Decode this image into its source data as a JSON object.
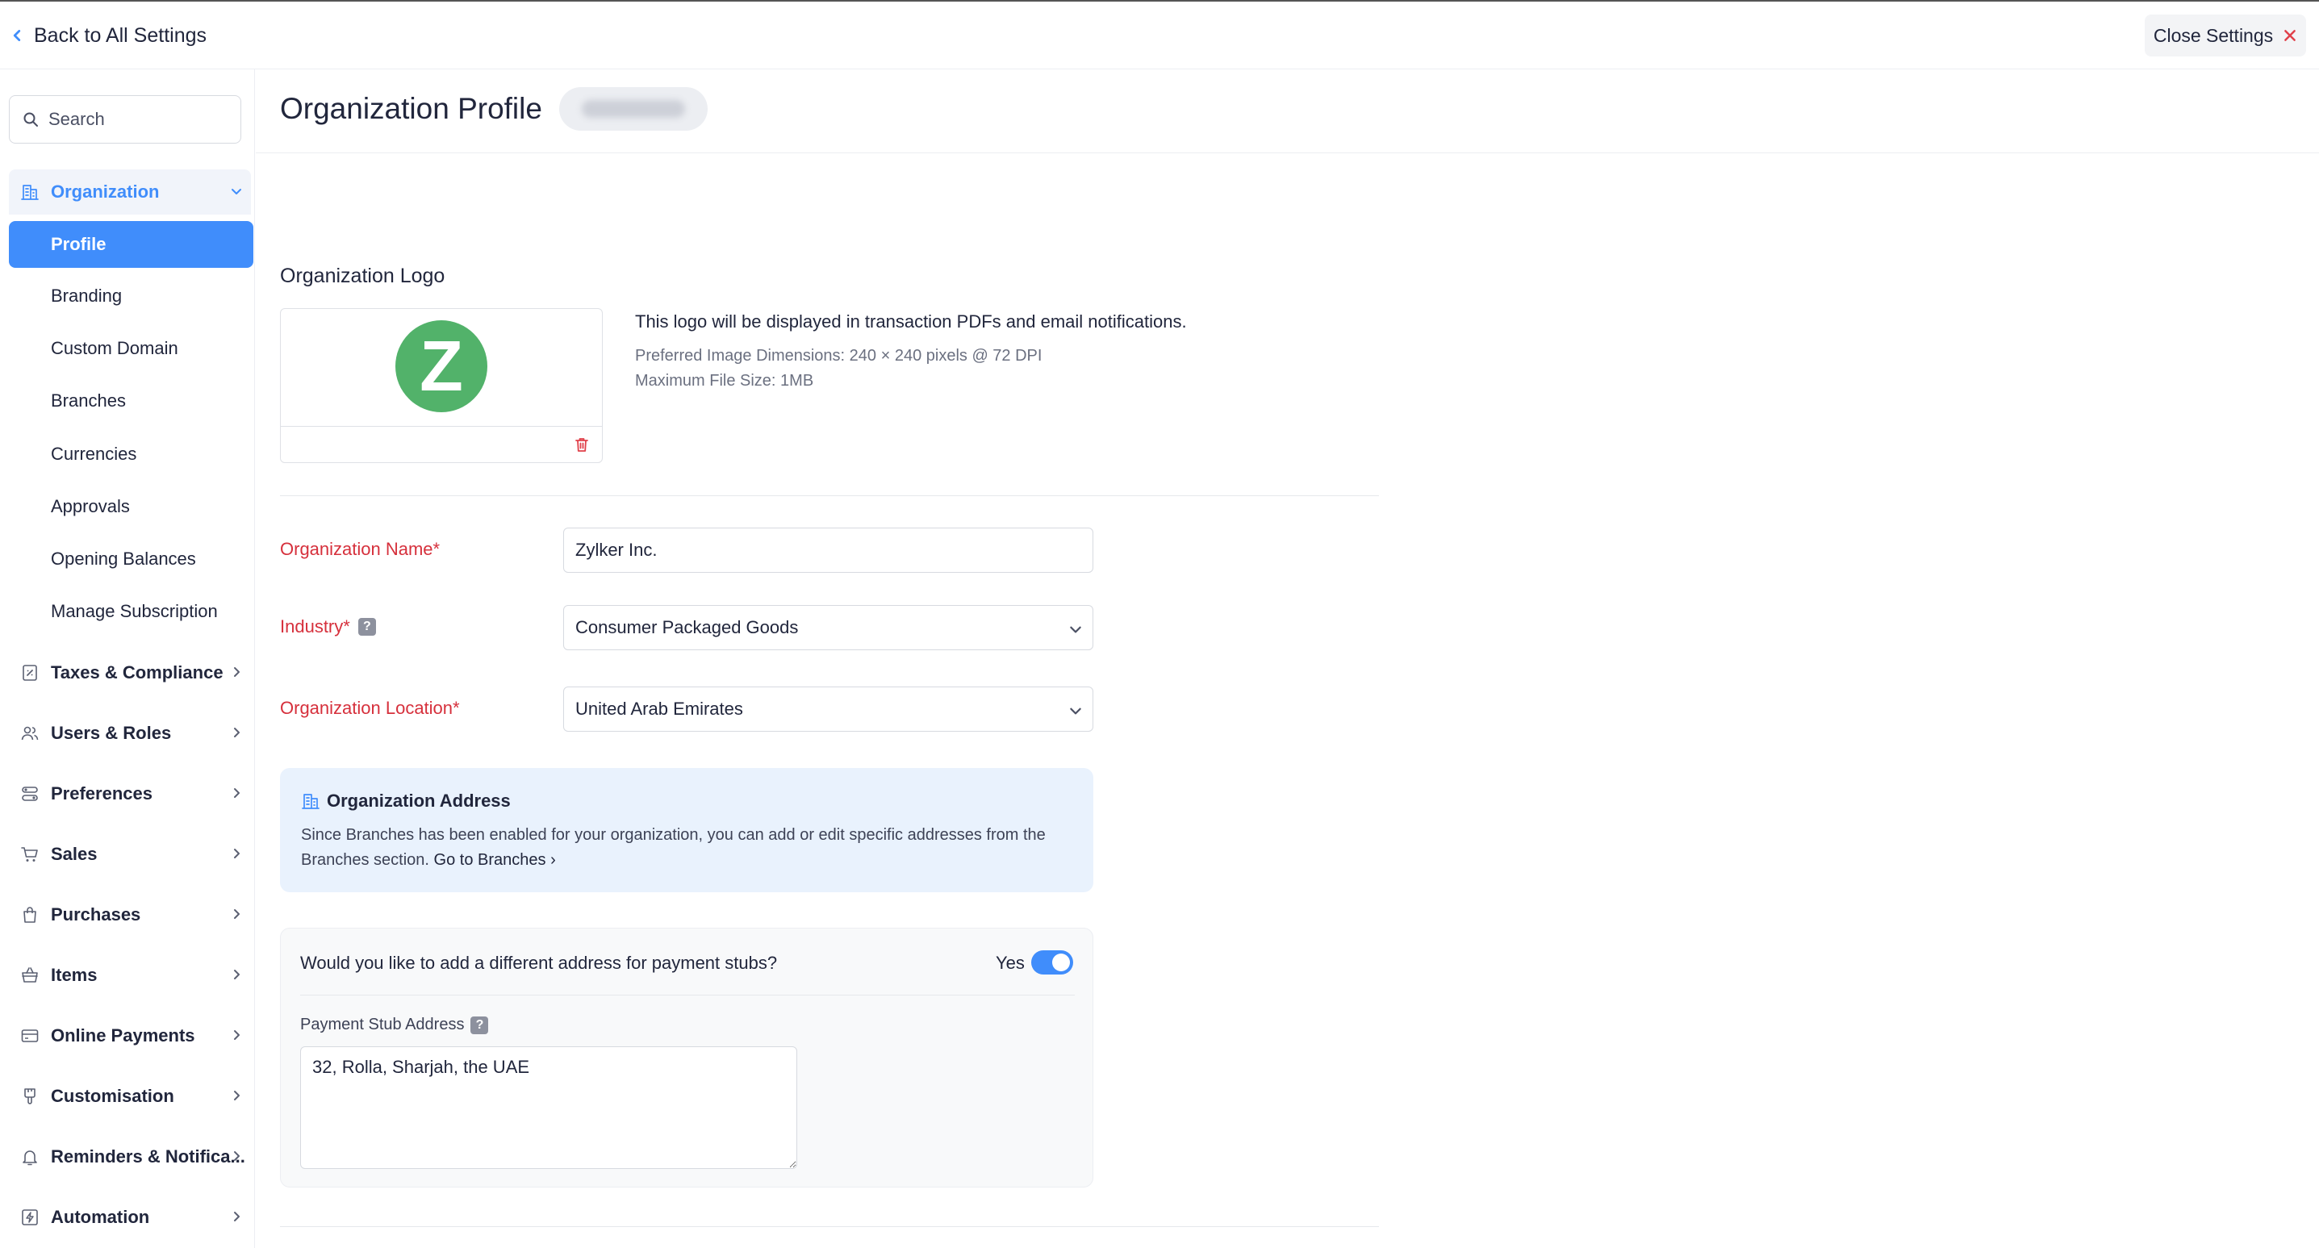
{
  "topbar": {
    "back_label": "Back to All Settings",
    "close_label": "Close Settings"
  },
  "sidebar": {
    "search_placeholder": "Search",
    "organization": {
      "label": "Organization",
      "items": [
        "Profile",
        "Branding",
        "Custom Domain",
        "Branches",
        "Currencies",
        "Approvals",
        "Opening Balances",
        "Manage Subscription"
      ],
      "active": "Profile"
    },
    "groups": [
      {
        "label": "Taxes & Compliance",
        "icon": "tax-icon"
      },
      {
        "label": "Users & Roles",
        "icon": "users-icon"
      },
      {
        "label": "Preferences",
        "icon": "preferences-icon"
      },
      {
        "label": "Sales",
        "icon": "cart-icon"
      },
      {
        "label": "Purchases",
        "icon": "bag-icon"
      },
      {
        "label": "Items",
        "icon": "basket-icon"
      },
      {
        "label": "Online Payments",
        "icon": "card-icon"
      },
      {
        "label": "Customisation",
        "icon": "brush-icon"
      },
      {
        "label": "Reminders & Notifica...",
        "icon": "bell-icon"
      },
      {
        "label": "Automation",
        "icon": "bolt-icon"
      }
    ]
  },
  "main": {
    "title": "Organization Profile",
    "logo_section": {
      "label": "Organization Logo",
      "logo_letter": "Z",
      "description": "This logo will be displayed in transaction PDFs and email notifications.",
      "dimensions": "Preferred Image Dimensions: 240 × 240 pixels @ 72 DPI",
      "max_size": "Maximum File Size: 1MB"
    },
    "fields": {
      "org_name_label": "Organization Name*",
      "org_name_value": "Zylker Inc.",
      "industry_label": "Industry*",
      "industry_value": "Consumer Packaged Goods",
      "location_label": "Organization Location*",
      "location_value": "United Arab Emirates"
    },
    "address_card": {
      "title": "Organization Address",
      "text": "Since Branches has been enabled for your organization, you can add or edit specific addresses from the Branches section.",
      "link": "Go to Branches ›"
    },
    "payment_stub": {
      "question": "Would you like to add a different address for payment stubs?",
      "toggle_label": "Yes",
      "toggle_on": true,
      "address_label": "Payment Stub Address",
      "address_value": "32, Rolla, Sharjah, the UAE"
    }
  },
  "colors": {
    "accent": "#408dfb",
    "required": "#d6303c",
    "logo_green": "#52b26a",
    "info_bg": "#e9f2fd"
  }
}
